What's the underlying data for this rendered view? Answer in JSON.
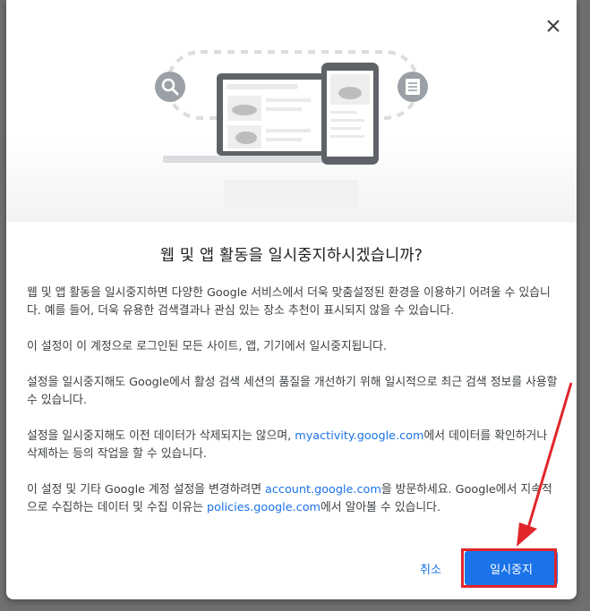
{
  "dialog": {
    "title": "웹 및 앱 활동을 일시중지하시겠습니까?",
    "paragraphs": {
      "p1": "웹 및 앱 활동을 일시중지하면 다양한 Google 서비스에서 더욱 맞춤설정된 환경을 이용하기 어려울 수 있습니다. 예를 들어, 더욱 유용한 검색결과나 관심 있는 장소 추천이 표시되지 않을 수 있습니다.",
      "p2": "이 설정이 이 계정으로 로그인된 모든 사이트, 앱, 기기에서 일시중지됩니다.",
      "p3": "설정을 일시중지해도 Google에서 활성 검색 세션의 품질을 개선하기 위해 일시적으로 최근 검색 정보를 사용할 수 있습니다.",
      "p4_before": "설정을 일시중지해도 이전 데이터가 삭제되지는 않으며, ",
      "p4_link": "myactivity.google.com",
      "p4_after": "에서 데이터를 확인하거나 삭제하는 등의 작업을 할 수 있습니다.",
      "p5_before": "이 설정 및 기타 Google 계정 설정을 변경하려면 ",
      "p5_link1": "account.google.com",
      "p5_middle": "을 방문하세요. Google에서 지속적으로 수집하는 데이터 및 수집 이유는 ",
      "p5_link2": "policies.google.com",
      "p5_after": "에서 알아볼 수 있습니다."
    },
    "buttons": {
      "cancel": "취소",
      "pause": "일시중지"
    }
  },
  "colors": {
    "accent": "#1a73e8",
    "annotation": "#e0262b",
    "text": "#3c4043",
    "title": "#202124"
  },
  "icons": [
    "close-icon",
    "search-icon",
    "document-icon",
    "laptop-illustration",
    "phone-illustration"
  ]
}
